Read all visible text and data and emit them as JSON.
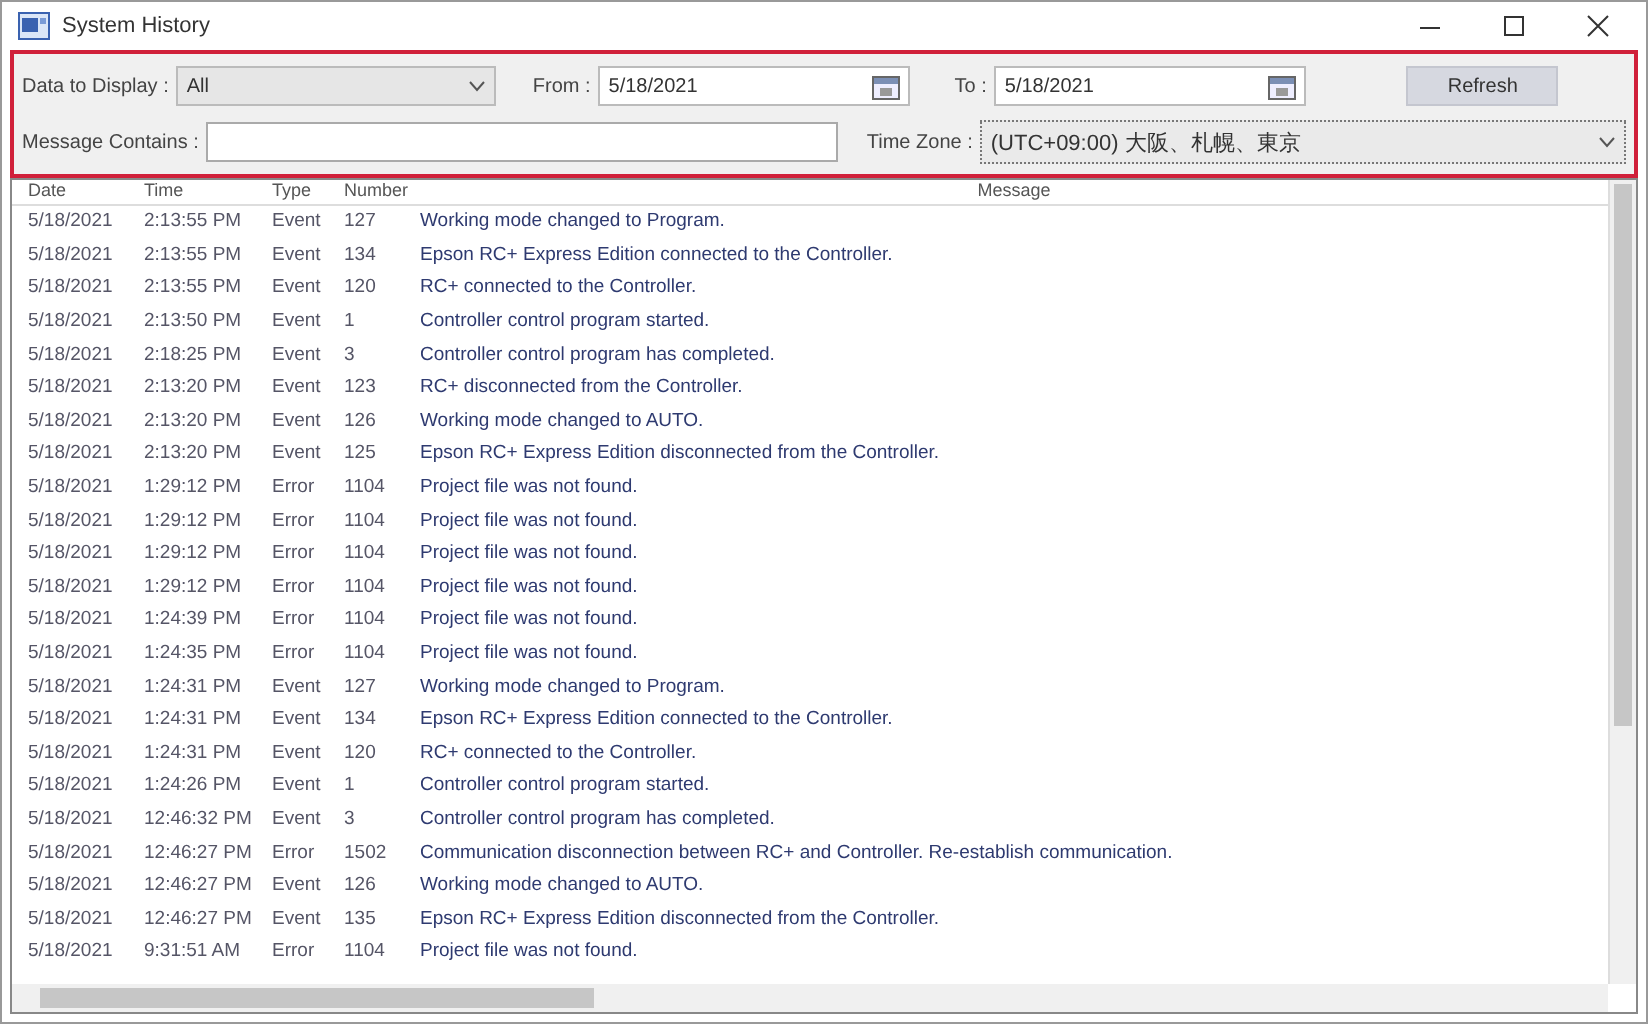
{
  "window": {
    "title": "System History"
  },
  "filters": {
    "data_label": "Data to Display :",
    "data_value": "All",
    "from_label": "From :",
    "from_value": "5/18/2021",
    "to_label": "To :",
    "to_value": "5/18/2021",
    "refresh": "Refresh",
    "message_label": "Message Contains :",
    "timezone_label": "Time Zone :",
    "timezone_value": "(UTC+09:00) 大阪、札幌、東京"
  },
  "table": {
    "columns": [
      "Date",
      "Time",
      "Type",
      "Number",
      "Message"
    ],
    "rows": [
      [
        "5/18/2021",
        "2:13:55 PM",
        "Event",
        "127",
        "Working mode changed to Program."
      ],
      [
        "5/18/2021",
        "2:13:55 PM",
        "Event",
        "134",
        "Epson RC+ Express Edition connected to the Controller."
      ],
      [
        "5/18/2021",
        "2:13:55 PM",
        "Event",
        "120",
        "RC+ connected to the Controller."
      ],
      [
        "5/18/2021",
        "2:13:50 PM",
        "Event",
        "1",
        "Controller control program started."
      ],
      [
        "5/18/2021",
        "2:18:25 PM",
        "Event",
        "3",
        "Controller control program has completed."
      ],
      [
        "5/18/2021",
        "2:13:20 PM",
        "Event",
        "123",
        "RC+ disconnected from the Controller."
      ],
      [
        "5/18/2021",
        "2:13:20 PM",
        "Event",
        "126",
        "Working mode changed to AUTO."
      ],
      [
        "5/18/2021",
        "2:13:20 PM",
        "Event",
        "125",
        "Epson RC+ Express Edition disconnected from the Controller."
      ],
      [
        "5/18/2021",
        "1:29:12 PM",
        "Error",
        "1104",
        "Project file was not found."
      ],
      [
        "5/18/2021",
        "1:29:12 PM",
        "Error",
        "1104",
        "Project file was not found."
      ],
      [
        "5/18/2021",
        "1:29:12 PM",
        "Error",
        "1104",
        "Project file was not found."
      ],
      [
        "5/18/2021",
        "1:29:12 PM",
        "Error",
        "1104",
        "Project file was not found."
      ],
      [
        "5/18/2021",
        "1:24:39 PM",
        "Error",
        "1104",
        "Project file was not found."
      ],
      [
        "5/18/2021",
        "1:24:35 PM",
        "Error",
        "1104",
        "Project file was not found."
      ],
      [
        "5/18/2021",
        "1:24:31 PM",
        "Event",
        "127",
        "Working mode changed to Program."
      ],
      [
        "5/18/2021",
        "1:24:31 PM",
        "Event",
        "134",
        "Epson RC+ Express Edition connected to the Controller."
      ],
      [
        "5/18/2021",
        "1:24:31 PM",
        "Event",
        "120",
        "RC+ connected to the Controller."
      ],
      [
        "5/18/2021",
        "1:24:26 PM",
        "Event",
        "1",
        "Controller control program started."
      ],
      [
        "5/18/2021",
        "12:46:32 PM",
        "Event",
        "3",
        "Controller control program has completed."
      ],
      [
        "5/18/2021",
        "12:46:27 PM",
        "Error",
        "1502",
        "Communication disconnection between RC+ and Controller. Re-establish communication."
      ],
      [
        "5/18/2021",
        "12:46:27 PM",
        "Event",
        "126",
        "Working mode changed to AUTO."
      ],
      [
        "5/18/2021",
        "12:46:27 PM",
        "Event",
        "135",
        "Epson RC+ Express Edition disconnected from the Controller."
      ],
      [
        "5/18/2021",
        "9:31:51 AM",
        "Error",
        "1104",
        "Project file was not found."
      ]
    ]
  }
}
